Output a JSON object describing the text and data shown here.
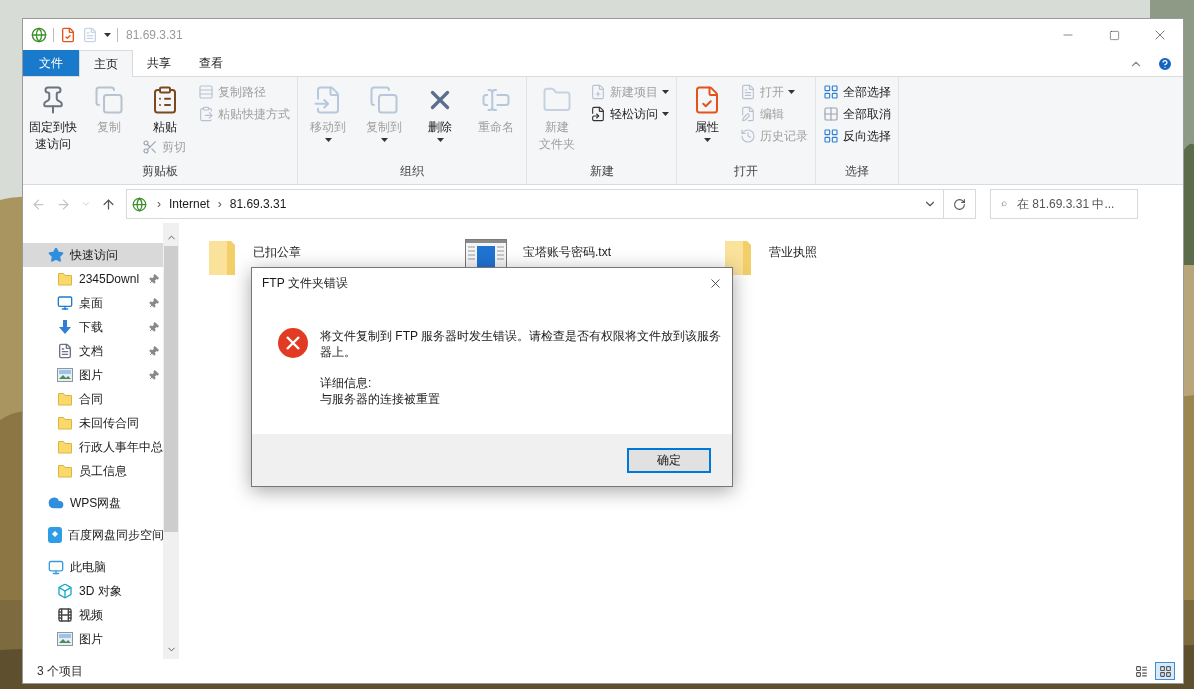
{
  "window": {
    "title": "81.69.3.31"
  },
  "ribbon_tabs": [
    {
      "label": "文件",
      "kind": "file",
      "selected": false
    },
    {
      "label": "主页",
      "kind": "tab",
      "selected": true
    },
    {
      "label": "共享",
      "kind": "tab",
      "selected": false
    },
    {
      "label": "查看",
      "kind": "tab",
      "selected": false
    }
  ],
  "ribbon_groups": [
    {
      "label": "剪贴板",
      "columns": [
        [
          {
            "lines": [
              "固定到快",
              "速访问"
            ],
            "kind": "large",
            "disabled": false,
            "dropdown": false
          }
        ],
        [
          {
            "label": "复制",
            "kind": "large",
            "disabled": true,
            "dropdown": false
          }
        ],
        [
          {
            "label": "粘贴",
            "kind": "large",
            "disabled": false,
            "dropdown": false
          },
          {
            "label": "剪切",
            "kind": "small",
            "disabled": true,
            "dropdown": false
          }
        ],
        [
          {
            "label": "复制路径",
            "kind": "small",
            "disabled": true,
            "dropdown": false
          },
          {
            "label": "粘贴快捷方式",
            "kind": "small",
            "disabled": true,
            "dropdown": false
          }
        ]
      ]
    },
    {
      "label": "组织",
      "columns": [
        [
          {
            "label": "移动到",
            "kind": "large",
            "disabled": true,
            "dropdown": true
          }
        ],
        [
          {
            "label": "复制到",
            "kind": "large",
            "disabled": true,
            "dropdown": true
          }
        ],
        [
          {
            "label": "删除",
            "kind": "large",
            "disabled": false,
            "dropdown": true
          }
        ],
        [
          {
            "label": "重命名",
            "kind": "large",
            "disabled": true,
            "dropdown": false
          }
        ]
      ]
    },
    {
      "label": "新建",
      "columns": [
        [
          {
            "lines": [
              "新建",
              "文件夹"
            ],
            "kind": "large",
            "disabled": true,
            "dropdown": false
          }
        ],
        [
          {
            "label": "新建项目",
            "kind": "small",
            "disabled": true,
            "dropdown": true
          },
          {
            "label": "轻松访问",
            "kind": "small",
            "disabled": false,
            "dropdown": true
          }
        ]
      ]
    },
    {
      "label": "打开",
      "columns": [
        [
          {
            "label": "属性",
            "kind": "large",
            "disabled": false,
            "dropdown": true
          }
        ],
        [
          {
            "label": "打开",
            "kind": "small",
            "disabled": true,
            "dropdown": true
          },
          {
            "label": "编辑",
            "kind": "small",
            "disabled": true,
            "dropdown": false
          },
          {
            "label": "历史记录",
            "kind": "small",
            "disabled": true,
            "dropdown": false
          }
        ]
      ]
    },
    {
      "label": "选择",
      "columns": [
        [
          {
            "label": "全部选择",
            "kind": "small",
            "disabled": false,
            "dropdown": false
          },
          {
            "label": "全部取消",
            "kind": "small",
            "disabled": false,
            "dropdown": false
          },
          {
            "label": "反向选择",
            "kind": "small",
            "disabled": false,
            "dropdown": false
          }
        ]
      ]
    }
  ],
  "address": {
    "segments": [
      {
        "separator": "›",
        "label": "Internet"
      },
      {
        "separator": "›",
        "label": "81.69.3.31"
      }
    ]
  },
  "search": {
    "placeholder": "在 81.69.3.31 中..."
  },
  "navigation": [
    {
      "label": "快速访问",
      "kind": "quick_access",
      "selected": true,
      "children": [
        {
          "label": "2345Downl",
          "kind": "folder",
          "pinned": true,
          "selected": false
        },
        {
          "label": "桌面",
          "kind": "desktop",
          "pinned": true,
          "selected": false
        },
        {
          "label": "下载",
          "kind": "download",
          "pinned": true,
          "selected": false
        },
        {
          "label": "文档",
          "kind": "documents",
          "pinned": true,
          "selected": false
        },
        {
          "label": "图片",
          "kind": "pictures",
          "pinned": true,
          "selected": false
        },
        {
          "label": "合同",
          "kind": "folder",
          "pinned": false,
          "selected": false
        },
        {
          "label": "未回传合同",
          "kind": "folder",
          "pinned": false,
          "selected": false
        },
        {
          "label": "行政人事年中总",
          "kind": "folder",
          "pinned": false,
          "selected": false
        },
        {
          "label": "员工信息",
          "kind": "folder",
          "pinned": false,
          "selected": false
        }
      ]
    },
    {
      "label": "WPS网盘",
      "kind": "cloud",
      "selected": false
    },
    {
      "label": "百度网盘同步空间",
      "kind": "sync_drive",
      "selected": false
    },
    {
      "label": "此电脑",
      "kind": "computer",
      "selected": false,
      "children": [
        {
          "label": "3D 对象",
          "kind": "objects_3d",
          "pinned": false,
          "selected": false
        },
        {
          "label": "视频",
          "kind": "videos",
          "pinned": false,
          "selected": false
        },
        {
          "label": "图片",
          "kind": "pictures",
          "pinned": false,
          "selected": false
        }
      ]
    }
  ],
  "files": [
    {
      "name": "已扣公章",
      "kind": "folder"
    },
    {
      "name": "宝塔账号密码.txt",
      "kind": "text_file"
    },
    {
      "name": "营业执照",
      "kind": "folder"
    }
  ],
  "dialog": {
    "title": "FTP 文件夹错误",
    "message": "将文件复制到 FTP 服务器时发生错误。请检查是否有权限将文件放到该服务器上。",
    "details_label": "详细信息:",
    "details": "与服务器的连接被重置",
    "button": "确定"
  },
  "status_bar": {
    "item_count": "3 个项目",
    "view_buttons": [
      {
        "selected": false
      },
      {
        "selected": true
      }
    ]
  }
}
